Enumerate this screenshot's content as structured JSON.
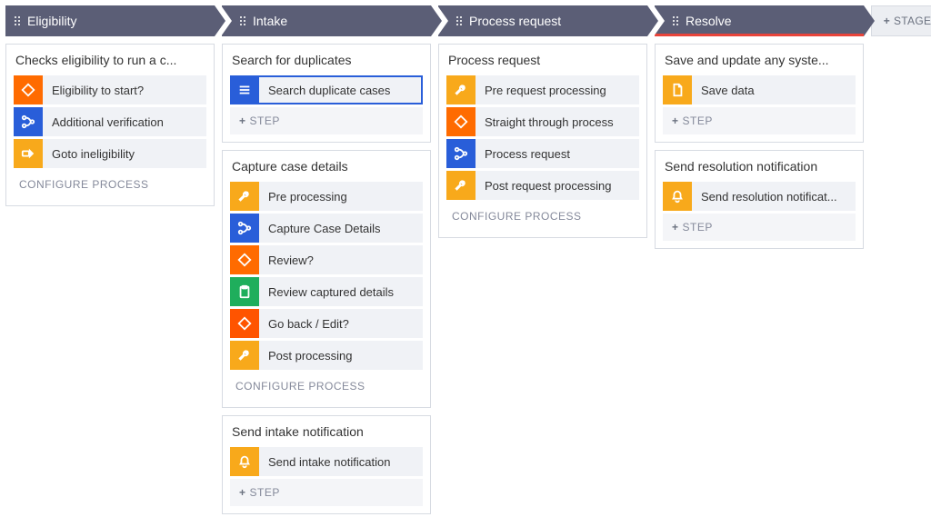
{
  "labels": {
    "add_stage": "STAGE",
    "add_step": "STEP",
    "configure": "CONFIGURE PROCESS"
  },
  "icons": {
    "diamond": "diamond-icon",
    "branch": "branch-icon",
    "arrow_right": "arrow-right-icon",
    "list": "list-icon",
    "wrench": "wrench-icon",
    "clipboard": "clipboard-icon",
    "bell": "bell-icon",
    "file": "file-icon"
  },
  "colors": {
    "stage_bg": "#5b5e76",
    "active_underline": "#e8443a",
    "orange": "#ff6b00",
    "yellow": "#f8a91b",
    "blue": "#295ed9",
    "green": "#1fae5c"
  },
  "stages": [
    {
      "title": "Eligibility",
      "active": false,
      "processes": [
        {
          "title": "Checks eligibility to run a c...",
          "steps": [
            {
              "label": "Eligibility to start?",
              "icon": "diamond",
              "color": "orange",
              "selected": false
            },
            {
              "label": "Additional verification",
              "icon": "branch",
              "color": "blue",
              "selected": false
            },
            {
              "label": "Goto ineligibility",
              "icon": "arrow_right",
              "color": "yellow",
              "selected": false
            }
          ],
          "show_add_step": false,
          "show_configure": true
        }
      ]
    },
    {
      "title": "Intake",
      "active": false,
      "processes": [
        {
          "title": "Search for duplicates",
          "steps": [
            {
              "label": "Search duplicate cases",
              "icon": "list",
              "color": "blue",
              "selected": true
            }
          ],
          "show_add_step": true,
          "show_configure": false
        },
        {
          "title": "Capture case details",
          "steps": [
            {
              "label": "Pre processing",
              "icon": "wrench",
              "color": "yellow",
              "selected": false
            },
            {
              "label": "Capture Case Details",
              "icon": "branch",
              "color": "blue",
              "selected": false
            },
            {
              "label": "Review?",
              "icon": "diamond",
              "color": "orange",
              "selected": false
            },
            {
              "label": "Review captured details",
              "icon": "clipboard",
              "color": "green",
              "selected": false
            },
            {
              "label": "Go back / Edit?",
              "icon": "diamond",
              "color": "orange-dark",
              "selected": false
            },
            {
              "label": "Post processing",
              "icon": "wrench",
              "color": "yellow",
              "selected": false
            }
          ],
          "show_add_step": false,
          "show_configure": true
        },
        {
          "title": "Send intake notification",
          "steps": [
            {
              "label": "Send intake notification",
              "icon": "bell",
              "color": "yellow",
              "selected": false
            }
          ],
          "show_add_step": true,
          "show_configure": false
        }
      ]
    },
    {
      "title": "Process request",
      "active": false,
      "processes": [
        {
          "title": "Process request",
          "steps": [
            {
              "label": "Pre request processing",
              "icon": "wrench",
              "color": "yellow",
              "selected": false
            },
            {
              "label": "Straight through process",
              "icon": "diamond",
              "color": "orange",
              "selected": false
            },
            {
              "label": "Process request",
              "icon": "branch",
              "color": "blue",
              "selected": false
            },
            {
              "label": "Post request processing",
              "icon": "wrench",
              "color": "yellow",
              "selected": false
            }
          ],
          "show_add_step": false,
          "show_configure": true
        }
      ]
    },
    {
      "title": "Resolve",
      "active": true,
      "processes": [
        {
          "title": "Save and update any syste...",
          "steps": [
            {
              "label": "Save data",
              "icon": "file",
              "color": "yellow",
              "selected": false
            }
          ],
          "show_add_step": true,
          "show_configure": false
        },
        {
          "title": "Send resolution notification",
          "steps": [
            {
              "label": "Send resolution notificat...",
              "icon": "bell",
              "color": "yellow",
              "selected": false
            }
          ],
          "show_add_step": true,
          "show_configure": false
        }
      ]
    }
  ]
}
